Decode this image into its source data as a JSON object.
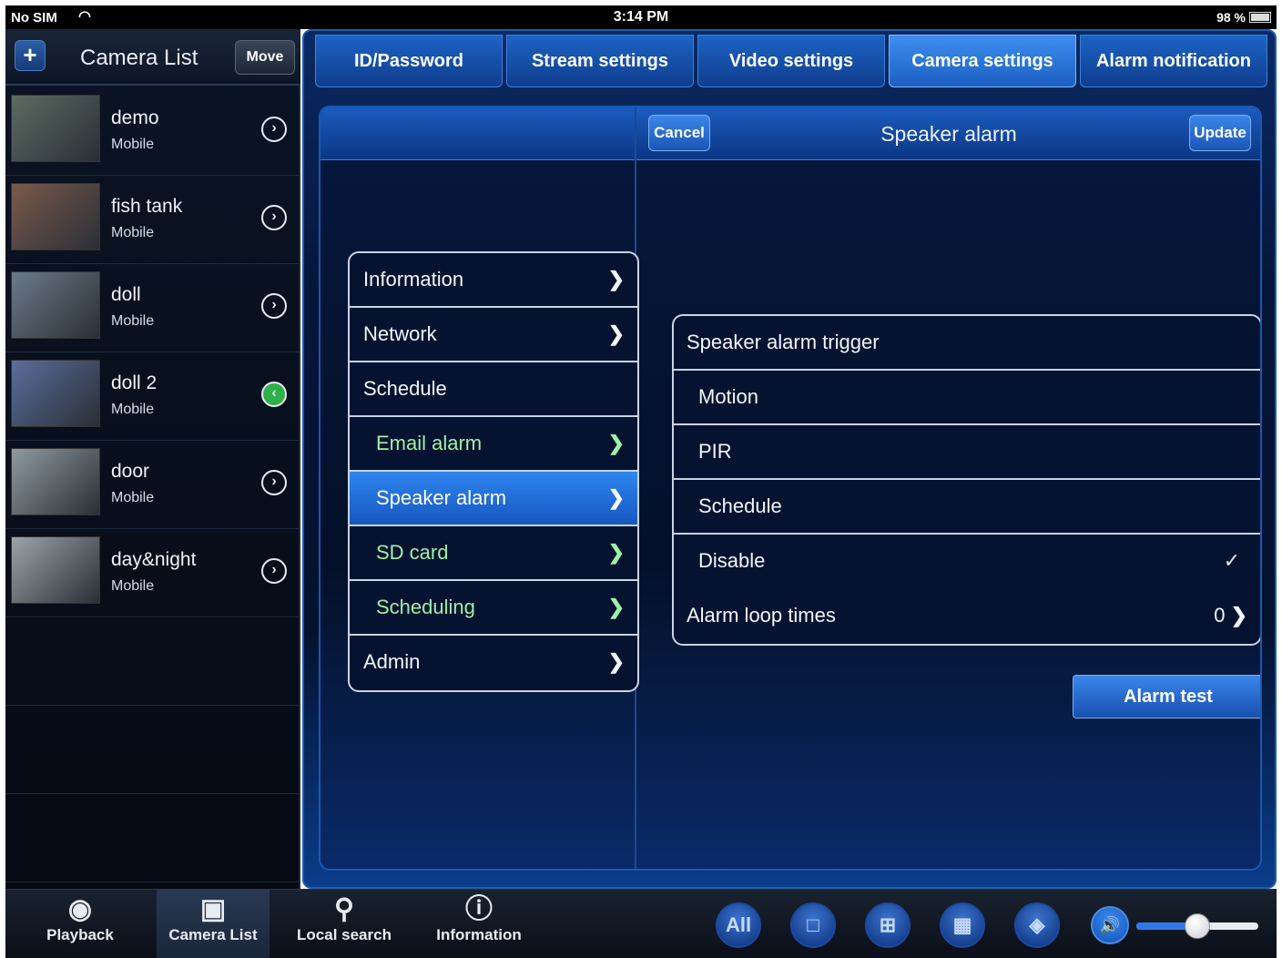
{
  "status_bar": {
    "carrier": "No SIM",
    "time": "3:14 PM",
    "battery": "98 %"
  },
  "camera_list": {
    "add_label": "+",
    "title": "Camera List",
    "move_label": "Move",
    "cameras": [
      {
        "name": "demo",
        "type": "Mobile",
        "active": false,
        "thumb": "#5d6b63"
      },
      {
        "name": "fish tank",
        "type": "Mobile",
        "active": false,
        "thumb": "#7a5a4c"
      },
      {
        "name": "doll",
        "type": "Mobile",
        "active": false,
        "thumb": "#6c7a88"
      },
      {
        "name": "doll 2",
        "type": "Mobile",
        "active": true,
        "thumb": "#5a6d9a"
      },
      {
        "name": "door",
        "type": "Mobile",
        "active": false,
        "thumb": "#8f9aa0"
      },
      {
        "name": "day&night",
        "type": "Mobile",
        "active": false,
        "thumb": "#9aa3a8"
      }
    ]
  },
  "tabs": [
    "ID/Password",
    "Stream settings",
    "Video settings",
    "Camera settings",
    "Alarm notification"
  ],
  "selected_tab": "Camera settings",
  "header": {
    "cancel_label": "Cancel",
    "title": "Speaker alarm",
    "update_label": "Update"
  },
  "menu": [
    {
      "label": "Information",
      "chevron": true,
      "sub": false,
      "selected": false
    },
    {
      "label": "Network",
      "chevron": true,
      "sub": false,
      "selected": false
    },
    {
      "label": "Schedule",
      "chevron": false,
      "sub": false,
      "selected": false
    },
    {
      "label": "Email alarm",
      "chevron": true,
      "sub": true,
      "selected": false
    },
    {
      "label": "Speaker alarm",
      "chevron": true,
      "sub": true,
      "selected": true
    },
    {
      "label": "SD card",
      "chevron": true,
      "sub": true,
      "selected": false
    },
    {
      "label": "Scheduling",
      "chevron": true,
      "sub": true,
      "selected": false
    },
    {
      "label": "Admin",
      "chevron": true,
      "sub": false,
      "selected": false
    }
  ],
  "options": {
    "trigger_label": "Speaker alarm trigger",
    "choices": [
      {
        "label": "Motion",
        "checked": false
      },
      {
        "label": "PIR",
        "checked": false
      },
      {
        "label": "Schedule",
        "checked": false
      },
      {
        "label": "Disable",
        "checked": true
      }
    ],
    "loop_label": "Alarm loop times",
    "loop_value": "0"
  },
  "alarm_test_label": "Alarm test",
  "toolbar": {
    "items": [
      {
        "label": "Playback",
        "icon": "playback-icon",
        "active": false
      },
      {
        "label": "Camera List",
        "icon": "camera-list-icon",
        "active": true
      },
      {
        "label": "Local search",
        "icon": "search-icon",
        "active": false
      },
      {
        "label": "Information",
        "icon": "info-icon",
        "active": false
      }
    ],
    "view_all_label": "All",
    "volume_level": 0.5
  }
}
